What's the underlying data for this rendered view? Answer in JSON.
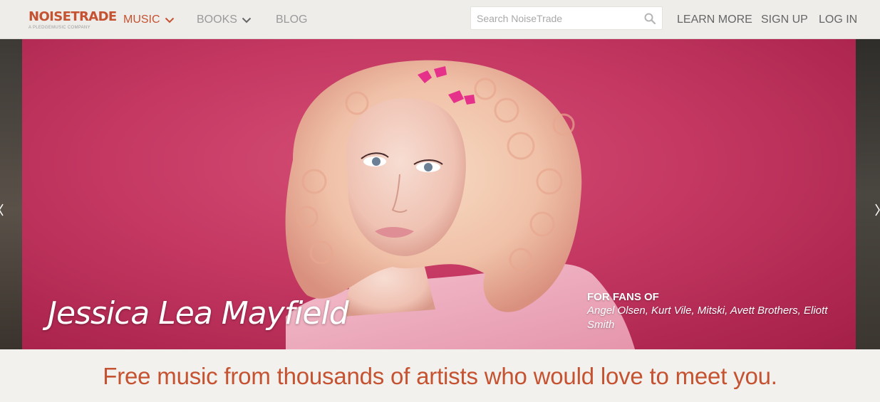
{
  "header": {
    "logo_text": "NOISETRADE",
    "logo_subtext": "A PLEDGEMUSIC COMPANY",
    "nav": [
      {
        "label": "MUSIC",
        "has_dropdown": true,
        "active": true
      },
      {
        "label": "BOOKS",
        "has_dropdown": true,
        "active": false
      },
      {
        "label": "BLOG",
        "has_dropdown": false,
        "active": false
      }
    ],
    "search_placeholder": "Search NoiseTrade",
    "search_value": "",
    "links": [
      "LEARN MORE",
      "SIGN UP",
      "LOG IN"
    ]
  },
  "hero": {
    "artist_name": "Jessica Lea Mayfield",
    "fans_label": "FOR FANS OF",
    "fans_list": "Angel Olsen, Kurt Vile, Mitski, Avett Brothers, Eliott Smith"
  },
  "tagline": "Free music from thousands of artists who would love to meet you.",
  "colors": {
    "accent": "#c55230",
    "hero_background": "#c43862",
    "header_background": "#eeedea"
  },
  "icons": {
    "search": "search-icon",
    "dropdown": "chevron-down-icon",
    "prev": "chevron-left-icon",
    "next": "chevron-right-icon"
  }
}
